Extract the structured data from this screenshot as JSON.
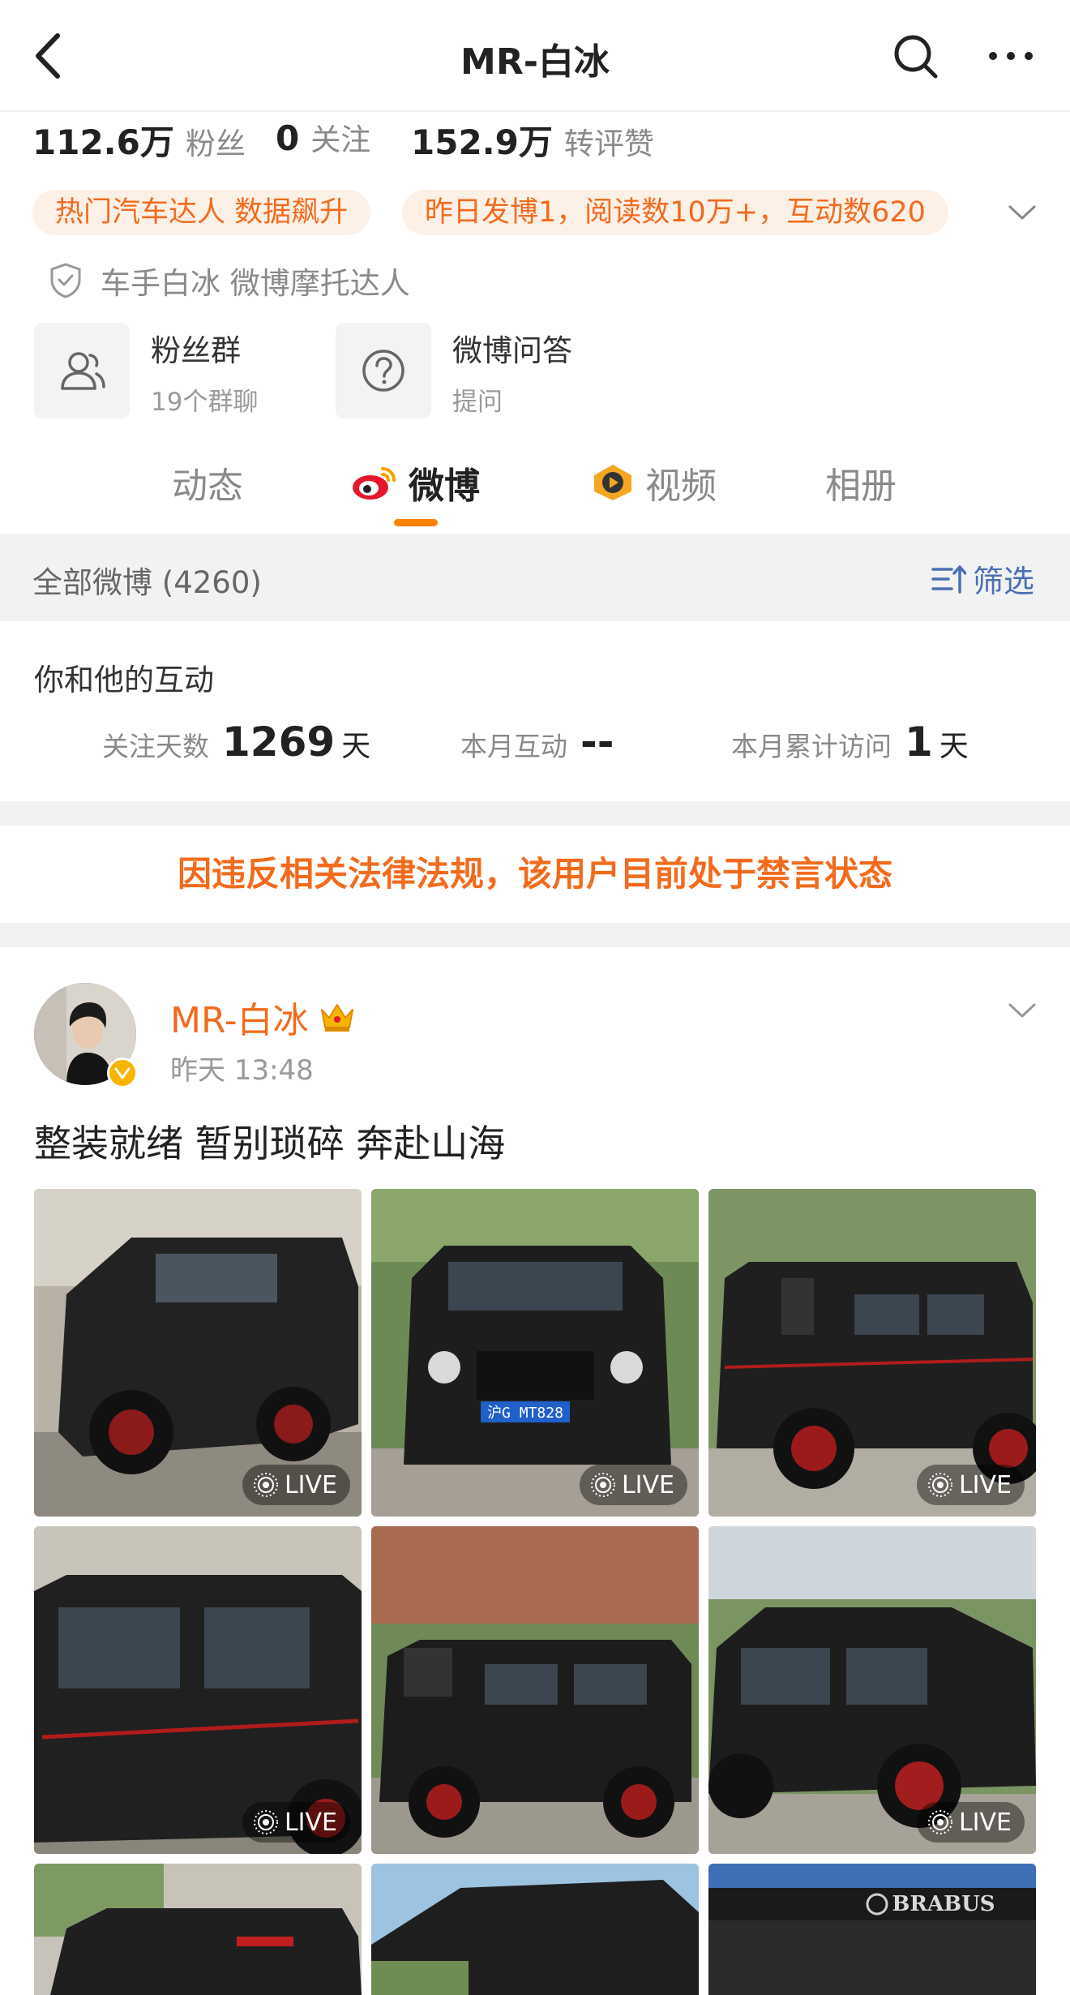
{
  "nav": {
    "title": "MR-白冰"
  },
  "stats": [
    {
      "value": "112.6万",
      "label": "粉丝"
    },
    {
      "value": "0",
      "label": "关注"
    },
    {
      "value": "152.9万",
      "label": "转评赞"
    }
  ],
  "chips": [
    "热门汽车达人 数据飙升",
    "昨日发博1，阅读数10万+，互动数620"
  ],
  "verification": "车手白冰 微博摩托达人",
  "tiles": [
    {
      "title": "粉丝群",
      "subtitle": "19个群聊",
      "icon": "users-icon"
    },
    {
      "title": "微博问答",
      "subtitle": "提问",
      "icon": "question-icon"
    }
  ],
  "tabs": [
    "动态",
    "微博",
    "视频",
    "相册"
  ],
  "active_tab": "微博",
  "filter": {
    "label": "全部微博 (4260)",
    "button": "筛选"
  },
  "interaction": {
    "title": "你和他的互动",
    "items": [
      {
        "label": "关注天数",
        "value": "1269",
        "unit": "天"
      },
      {
        "label": "本月互动",
        "value": "--",
        "unit": ""
      },
      {
        "label": "本月累计访问",
        "value": "1",
        "unit": "天"
      }
    ]
  },
  "ban_notice": "因违反相关法律法规，该用户目前处于禁言状态",
  "post": {
    "author": "MR-白冰",
    "time": "昨天 13:48",
    "text": "整装就绪 暂别琐碎 奔赴山海",
    "live_label": "LIVE",
    "plate": "沪G MT828",
    "brand_text": "BRABUS"
  },
  "colors": {
    "accent": "#f26b1d",
    "tab_indicator": "#ff8200",
    "link": "#4b6fb5"
  }
}
